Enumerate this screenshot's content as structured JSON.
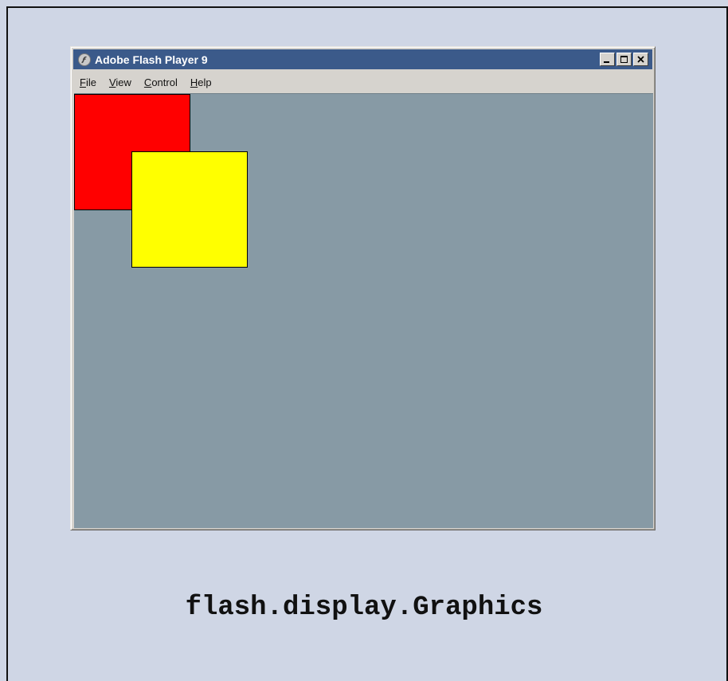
{
  "window": {
    "title": "Adobe Flash Player 9"
  },
  "menu": {
    "items": [
      {
        "label": "File",
        "mnemonic": "F",
        "rest": "ile"
      },
      {
        "label": "View",
        "mnemonic": "V",
        "rest": "iew"
      },
      {
        "label": "Control",
        "mnemonic": "C",
        "rest": "ontrol"
      },
      {
        "label": "Help",
        "mnemonic": "H",
        "rest": "elp"
      }
    ]
  },
  "stage": {
    "background": "#879aa5",
    "shapes": [
      {
        "name": "red-square",
        "color": "#ff0000"
      },
      {
        "name": "yellow-square",
        "color": "#ffff00"
      }
    ]
  },
  "caption": "flash.display.Graphics",
  "icons": {
    "app": "flash-player-icon",
    "minimize": "minimize-icon",
    "maximize": "maximize-icon",
    "close": "close-icon"
  }
}
